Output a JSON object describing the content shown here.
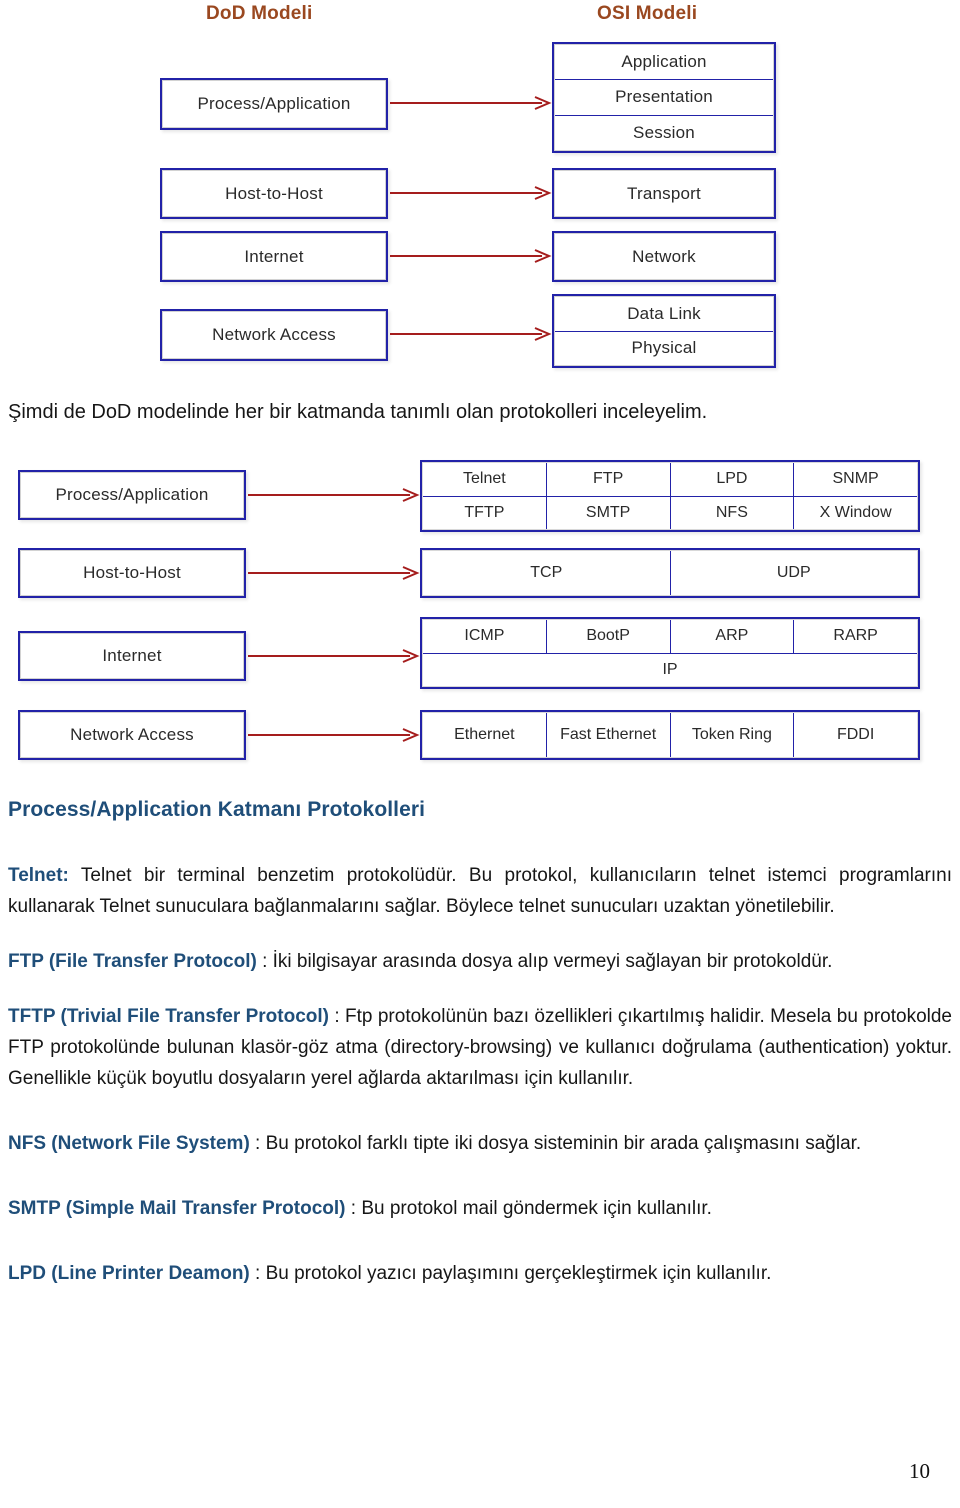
{
  "diagram_osi": {
    "titles": {
      "dod": "DoD Modeli",
      "osi": "OSI Modeli"
    },
    "dod_layers": [
      "Process/Application",
      "Host-to-Host",
      "Internet",
      "Network Access"
    ],
    "osi_groups": [
      [
        "Application",
        "Presentation",
        "Session"
      ],
      [
        "Transport"
      ],
      [
        "Network"
      ],
      [
        "Data Link",
        "Physical"
      ]
    ]
  },
  "diagram_protocols": {
    "dod_layers": [
      "Process/Application",
      "Host-to-Host",
      "Internet",
      "Network Access"
    ],
    "process_application": [
      [
        "Telnet",
        "FTP",
        "LPD",
        "SNMP"
      ],
      [
        "TFTP",
        "SMTP",
        "NFS",
        "X Window"
      ]
    ],
    "host_to_host": [
      [
        "TCP",
        "UDP"
      ]
    ],
    "internet": [
      [
        "ICMP",
        "BootP",
        "ARP",
        "RARP"
      ],
      [
        "IP"
      ]
    ],
    "network_access": [
      [
        "Ethernet",
        "Fast Ethernet",
        "Token  Ring",
        "FDDI"
      ]
    ]
  },
  "caption": "Şimdi de DoD modelinde her bir katmanda tanımlı olan protokolleri inceleyelim.",
  "section_title": "Process/Application Katmanı Protokolleri",
  "paragraphs": [
    {
      "term": "Telnet:",
      "body": " Telnet bir terminal benzetim protokolüdür. Bu protokol, kullanıcıların telnet istemci programlarını kullanarak Telnet sunuculara bağlanmalarını sağlar. Böylece telnet sunucuları uzaktan yönetilebilir."
    },
    {
      "term": "FTP (File Transfer Protocol)",
      "body": " : İki bilgisayar arasında dosya alıp vermeyi sağlayan bir protokoldür."
    },
    {
      "term": "TFTP (Trivial File Transfer Protocol)",
      "body": " : Ftp protokolünün bazı özellikleri çıkartılmış halidir. Mesela bu protokolde FTP protokolünde bulunan klasör-göz atma (directory-browsing) ve kullanıcı doğrulama (authentication) yoktur. Genellikle küçük boyutlu dosyaların yerel ağlarda aktarılması için kullanılır."
    },
    {
      "term": "NFS (Network File System)",
      "body": " : Bu protokol farklı tipte iki dosya sisteminin bir arada çalışmasını sağlar."
    },
    {
      "term": "SMTP (Simple Mail Transfer Protocol)",
      "body": " : Bu protokol mail göndermek için kullanılır."
    },
    {
      "term": "LPD (Line Printer Deamon)",
      "body": " : Bu protokol yazıcı paylaşımını gerçekleştirmek için kullanılır."
    }
  ],
  "page_number": "10",
  "colors": {
    "diagram_title": "#9a4820",
    "box_border": "#2222a8",
    "arrow": "#a51d1d",
    "heading": "#1F4E79",
    "term": "#1F4E79",
    "body_text": "#161616"
  }
}
